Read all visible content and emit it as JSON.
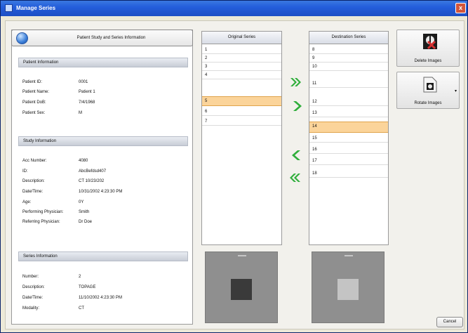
{
  "window": {
    "title": "Manage Series",
    "close_label": "x"
  },
  "patient_header": {
    "label": "Patient Study and Series Information"
  },
  "sections": {
    "patient": {
      "title": "Patient Information",
      "rows": [
        {
          "key": "Patient ID:",
          "value": "0001"
        },
        {
          "key": "Patient Name:",
          "value": "Patient 1"
        },
        {
          "key": "Patient DoB:",
          "value": "7/4/1968"
        },
        {
          "key": "Patient Sex:",
          "value": "M"
        }
      ]
    },
    "study": {
      "title": "Study Information",
      "rows": [
        {
          "key": "Acc Number:",
          "value": "4080"
        },
        {
          "key": "ID:",
          "value": "AbcBefdsd407"
        },
        {
          "key": "Description:",
          "value": "CT 10/23/202"
        },
        {
          "key": "Date/Time:",
          "value": "10/31/2002 4:23:30 PM"
        },
        {
          "key": "Age:",
          "value": "0Y"
        },
        {
          "key": "Performing Physician:",
          "value": "Smith"
        },
        {
          "key": "Referring Physician:",
          "value": "Dr Doe"
        }
      ]
    },
    "series": {
      "title": "Series Information",
      "rows": [
        {
          "key": "Number:",
          "value": "2"
        },
        {
          "key": "Description:",
          "value": "TOPAGE"
        },
        {
          "key": "Date/Time:",
          "value": "11/10/2002 4:23:30 PM"
        },
        {
          "key": "Modality:",
          "value": "CT"
        }
      ]
    }
  },
  "original_series": {
    "header": "Original Series",
    "items": [
      "1",
      "2",
      "3",
      "4",
      "5",
      "6",
      "7"
    ],
    "selected": "5"
  },
  "destination_series": {
    "header": "Destination Series",
    "items": [
      "8",
      "9",
      "10",
      "11",
      "12",
      "13",
      "14",
      "15",
      "16",
      "17",
      "18"
    ],
    "selected": "14"
  },
  "tools": {
    "delete_label": "Delete Images",
    "rotate_label": "Rotate Images"
  },
  "cancel_label": "Cancel",
  "colors": {
    "selection": "#fbd49a",
    "arrow_green": "#2fae3b",
    "titlebar": "#245edb"
  }
}
